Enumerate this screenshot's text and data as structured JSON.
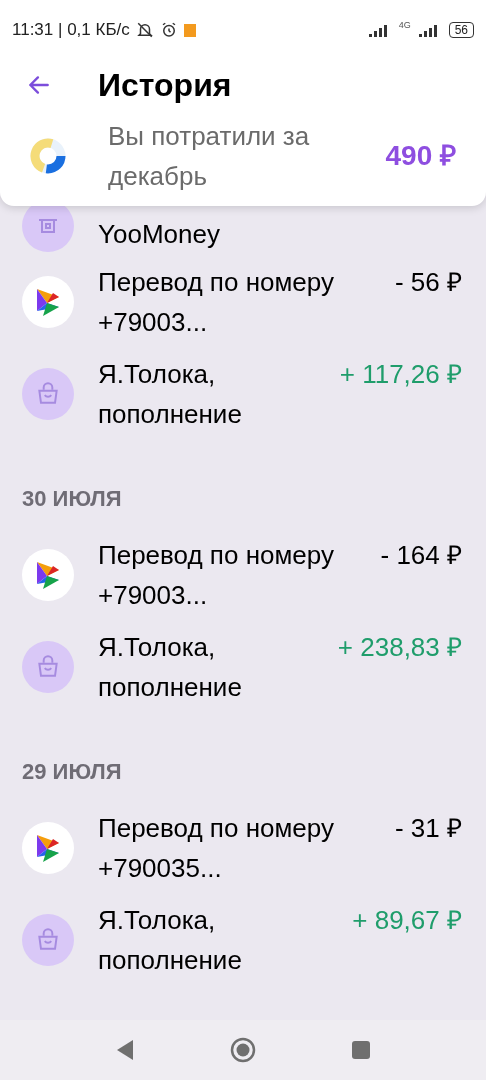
{
  "status_bar": {
    "time": "11:31 | 0,1 КБ/с",
    "network": "4G",
    "battery": "56"
  },
  "header": {
    "title": "История",
    "summary": "Вы потратили за декабрь",
    "amount": "490 ₽"
  },
  "partial_item": {
    "kind": "atm",
    "title": "YooMoney"
  },
  "groups": [
    {
      "items": [
        {
          "kind": "sbp",
          "title": "Перевод по номеру +79003...",
          "amount": "- 56 ₽",
          "incoming": false
        },
        {
          "kind": "shop",
          "title": "Я.Толока, пополнение",
          "amount": "+ 117,26 ₽",
          "incoming": true
        }
      ]
    },
    {
      "date": "30 ИЮЛЯ",
      "items": [
        {
          "kind": "sbp",
          "title": "Перевод по номеру +79003...",
          "amount": "- 164 ₽",
          "incoming": false
        },
        {
          "kind": "shop",
          "title": "Я.Толока, пополнение",
          "amount": "+ 238,83 ₽",
          "incoming": true
        }
      ]
    },
    {
      "date": "29 ИЮЛЯ",
      "items": [
        {
          "kind": "sbp",
          "title": "Перевод по номеру +790035...",
          "amount": "- 31 ₽",
          "incoming": false
        },
        {
          "kind": "shop",
          "title": "Я.Толока, пополнение",
          "amount": "+ 89,67 ₽",
          "incoming": true
        }
      ]
    }
  ]
}
